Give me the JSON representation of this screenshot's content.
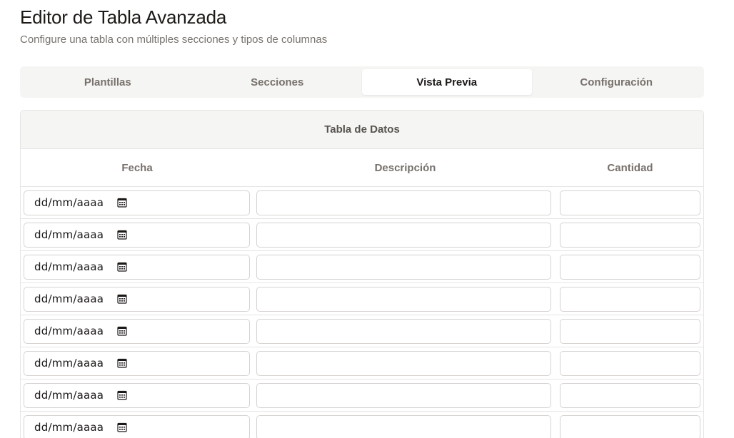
{
  "header": {
    "title": "Editor de Tabla Avanzada",
    "subtitle": "Configure una tabla con múltiples secciones y tipos de columnas"
  },
  "tabs": [
    {
      "label": "Plantillas",
      "active": false
    },
    {
      "label": "Secciones",
      "active": false
    },
    {
      "label": "Vista Previa",
      "active": true
    },
    {
      "label": "Configuración",
      "active": false
    }
  ],
  "table": {
    "title": "Tabla de Datos",
    "columns": [
      "Fecha",
      "Descripción",
      "Cantidad"
    ],
    "rows": [
      {
        "fecha_placeholder": "dd/mm/aaaa",
        "descripcion": "",
        "cantidad": ""
      },
      {
        "fecha_placeholder": "dd/mm/aaaa",
        "descripcion": "",
        "cantidad": ""
      },
      {
        "fecha_placeholder": "dd/mm/aaaa",
        "descripcion": "",
        "cantidad": ""
      },
      {
        "fecha_placeholder": "dd/mm/aaaa",
        "descripcion": "",
        "cantidad": ""
      },
      {
        "fecha_placeholder": "dd/mm/aaaa",
        "descripcion": "",
        "cantidad": ""
      },
      {
        "fecha_placeholder": "dd/mm/aaaa",
        "descripcion": "",
        "cantidad": ""
      },
      {
        "fecha_placeholder": "dd/mm/aaaa",
        "descripcion": "",
        "cantidad": ""
      },
      {
        "fecha_placeholder": "dd/mm/aaaa",
        "descripcion": "",
        "cantidad": ""
      }
    ],
    "date_icon": "calendar-icon"
  },
  "colors": {
    "tab_bg": "#f5f5f4",
    "border": "#e7e5e4",
    "muted_text": "#78716c"
  }
}
